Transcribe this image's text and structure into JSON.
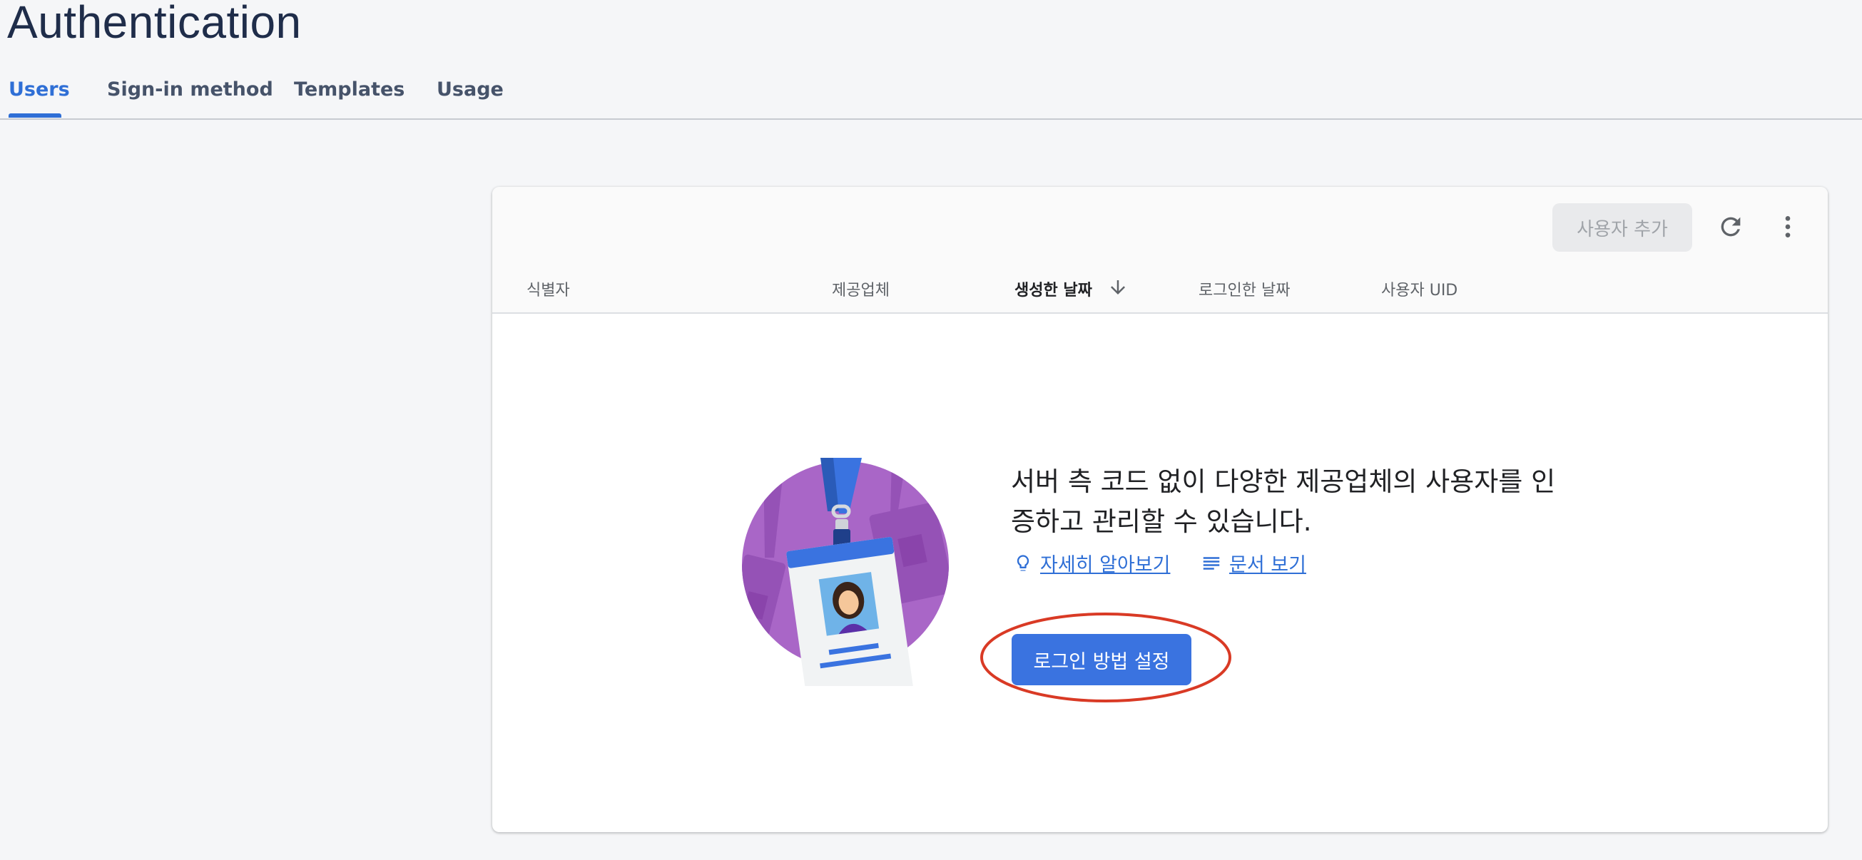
{
  "header": {
    "title": "Authentication"
  },
  "tabs": [
    {
      "label": "Users",
      "active": true
    },
    {
      "label": "Sign-in method",
      "active": false
    },
    {
      "label": "Templates",
      "active": false
    },
    {
      "label": "Usage",
      "active": false
    }
  ],
  "toolbar": {
    "add_user_label": "사용자 추가",
    "refresh_icon": "refresh-icon",
    "more_icon": "more-vert-icon"
  },
  "table": {
    "columns": [
      "식별자",
      "제공업체",
      "생성한 날짜",
      "로그인한 날짜",
      "사용자 UID"
    ],
    "sorted_column": "생성한 날짜",
    "sort_direction": "descending"
  },
  "empty_state": {
    "message": "서버 측 코드 없이 다양한 제공업체의 사용자를 인증하고 관리할 수 있습니다.",
    "learn_more_label": "자세히 알아보기",
    "docs_label": "문서 보기",
    "setup_button_label": "로그인 방법 설정"
  },
  "colors": {
    "accent": "#2f6fd6",
    "primary_button": "#3a73e0",
    "highlight_ellipse": "#d93a25",
    "illustration_circle": "#a966c7"
  }
}
